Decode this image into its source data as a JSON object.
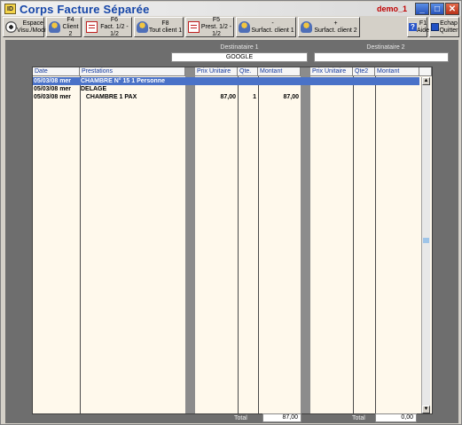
{
  "window": {
    "title": "Corps Facture Séparée",
    "user": "demo_1",
    "icon_label": "ID"
  },
  "toolbar": [
    {
      "key": "espace",
      "icon": "eye-icon",
      "line1": "Espace",
      "line2": "Visu./Modif."
    },
    {
      "key": "f4",
      "icon": "person-icon",
      "line1": "F4",
      "line2": "Client 2"
    },
    {
      "key": "f6",
      "icon": "invoice-icon",
      "line1": "F6",
      "line2": "Fact. 1/2 - 1/2"
    },
    {
      "key": "f8",
      "icon": "person-icon",
      "line1": "F8",
      "line2": "Tout client 1"
    },
    {
      "key": "f5",
      "icon": "invoice-icon",
      "line1": "F5",
      "line2": "Prest. 1/2 - 1/2"
    },
    {
      "key": "minus",
      "icon": "person-icon",
      "line1": "-",
      "line2": "Surfact. client 1"
    },
    {
      "key": "plus",
      "icon": "person-icon",
      "line1": "+",
      "line2": "Surfact. client 2"
    },
    {
      "key": "aide",
      "icon": "help-icon",
      "line1": "F1",
      "line2": "Aide"
    },
    {
      "key": "quitter",
      "icon": "exit-icon",
      "line1": "Echap",
      "line2": "Quitter"
    }
  ],
  "destinataires": {
    "d1_label": "Destinataire 1",
    "d1_value": "GOOGLE",
    "d2_label": "Destinataire 2",
    "d2_value": ""
  },
  "columns": {
    "date": "Date",
    "prestations": "Prestations",
    "prix1": "Prix Unitaire",
    "qte1": "Qte.",
    "montant1": "Montant",
    "prix2": "Prix Unitaire",
    "qte2": "Qte2",
    "montant2": "Montant"
  },
  "rows": [
    {
      "date": "05/03/08 mer",
      "prestation": "CHAMBRE N° 15 1 Personne",
      "prix": "",
      "qte": "",
      "montant": "",
      "selected": true
    },
    {
      "date": "05/03/08 mer",
      "prestation": "DELAGE",
      "prix": "",
      "qte": "",
      "montant": "",
      "selected": false
    },
    {
      "date": "05/03/08 mer",
      "prestation": "   CHAMBRE 1 PAX",
      "prix": "87,00",
      "qte": "1",
      "montant": "87,00",
      "selected": false
    }
  ],
  "totals": {
    "label1": "Total",
    "value1": "87,00",
    "label2": "Total",
    "value2": "0,00"
  },
  "colors": {
    "title": "#1646a8",
    "user": "#c00000",
    "selection": "#4a72c8",
    "grid_bg": "#fff9ec",
    "frame_bg": "#6e6e6e"
  }
}
